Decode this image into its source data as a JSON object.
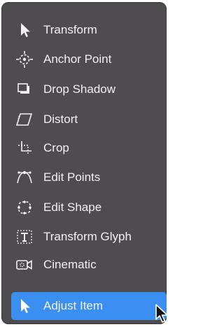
{
  "menu": {
    "items": [
      {
        "label": "Transform",
        "icon": "arrow-pointer-icon"
      },
      {
        "label": "Anchor Point",
        "icon": "anchor-point-icon"
      },
      {
        "label": "Drop Shadow",
        "icon": "drop-shadow-icon"
      },
      {
        "label": "Distort",
        "icon": "distort-icon"
      },
      {
        "label": "Crop",
        "icon": "crop-icon"
      },
      {
        "label": "Edit Points",
        "icon": "edit-points-icon"
      },
      {
        "label": "Edit Shape",
        "icon": "edit-shape-icon"
      },
      {
        "label": "Transform Glyph",
        "icon": "transform-glyph-icon"
      },
      {
        "label": "Cinematic",
        "icon": "cinematic-icon"
      },
      {
        "label": "Adjust Item",
        "icon": "arrow-pointer-icon",
        "selected": true
      }
    ]
  },
  "colors": {
    "menu_background": "#4e4c4e",
    "selected_background": "#3a8ff0",
    "text": "#f2f2f2"
  }
}
